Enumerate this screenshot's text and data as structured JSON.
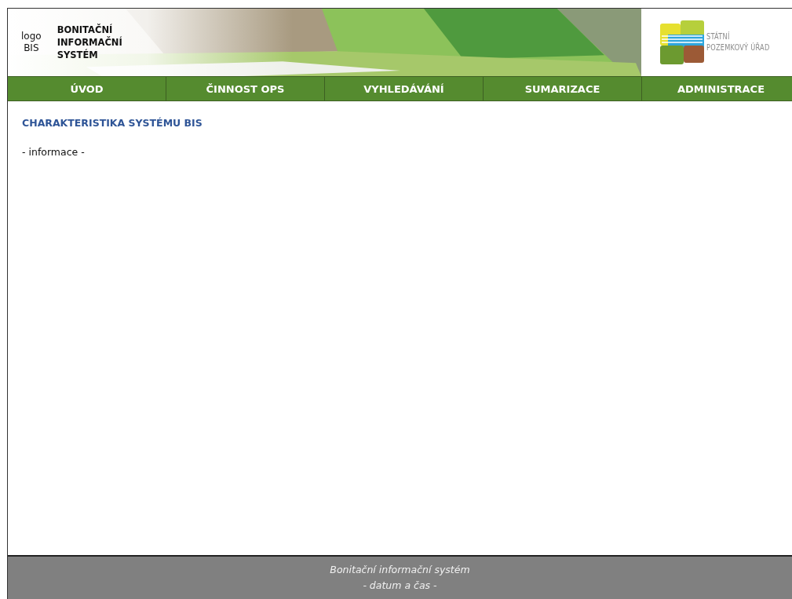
{
  "header": {
    "logo_placeholder": [
      "logo",
      "BIS"
    ],
    "system_name": [
      "BONITAČNÍ",
      "INFORMAČNÍ",
      "SYSTÉM"
    ],
    "banner": {
      "kind": "picture"
    },
    "agency_logo": [
      "STÁTNÍ",
      "POZEMKOVÝ ÚŘAD"
    ]
  },
  "nav": [
    {
      "label": "ÚVOD"
    },
    {
      "label": "ČINNOST OPS"
    },
    {
      "label": "VYHLEDÁVÁNÍ"
    },
    {
      "label": "SUMARIZACE"
    },
    {
      "label": "ADMINISTRACE"
    }
  ],
  "content": {
    "heading": "CHARAKTERISTIKA SYSTÉMU BIS",
    "text": "- informace -"
  },
  "footer": [
    "Bonitační informační systém",
    "- datum a čas -"
  ]
}
